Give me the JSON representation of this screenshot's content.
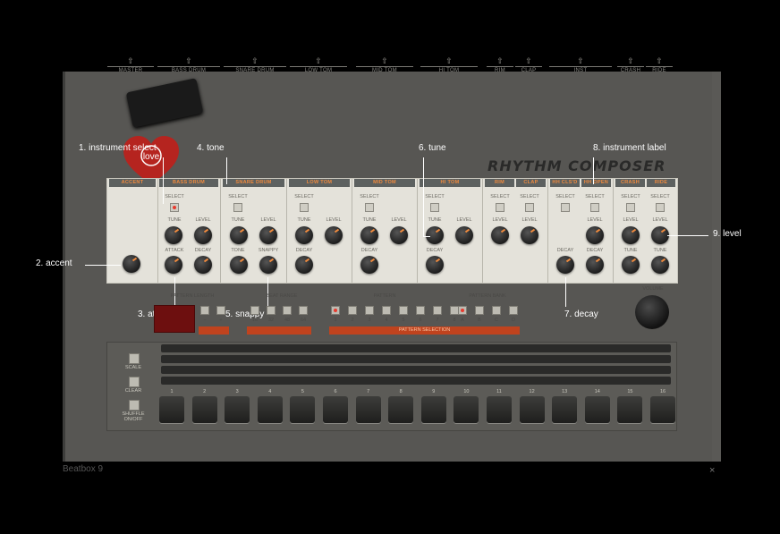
{
  "window": {
    "title": "Beatbox 9",
    "close_glyph": "×"
  },
  "brand": {
    "logo": "RHYTHM COMPOSER",
    "heart_text": "love"
  },
  "outputs": [
    "MASTER",
    "BASS DRUM",
    "SNARE DRUM",
    "LOW TOM",
    "MID TOM",
    "HI TOM",
    "RIM",
    "CLAP",
    "INST",
    "CRASH",
    "RIDE"
  ],
  "panel": {
    "accent": "ACCENT",
    "columns": [
      {
        "name": "BASS DRUM",
        "rows": [
          "SELECT",
          "TUNE",
          "LEVEL",
          "ATTACK",
          "DECAY"
        ]
      },
      {
        "name": "SNARE DRUM",
        "rows": [
          "SELECT",
          "TUNE",
          "LEVEL",
          "TONE",
          "SNAPPY"
        ]
      },
      {
        "name": "LOW TOM",
        "rows": [
          "SELECT",
          "TUNE",
          "LEVEL",
          "DECAY"
        ]
      },
      {
        "name": "MID TOM",
        "rows": [
          "SELECT",
          "TUNE",
          "LEVEL",
          "DECAY"
        ]
      },
      {
        "name": "HI TOM",
        "rows": [
          "SELECT",
          "TUNE",
          "LEVEL",
          "DECAY"
        ]
      },
      {
        "name": "RIM",
        "rows": [
          "SELECT",
          "LEVEL"
        ]
      },
      {
        "name": "CLAP",
        "rows": [
          "SELECT",
          "LEVEL"
        ]
      },
      {
        "name": "HH CLS'D",
        "rows": [
          "SELECT",
          "DECAY"
        ]
      },
      {
        "name": "HH OPEN",
        "rows": [
          "SELECT",
          "LEVEL",
          "DECAY"
        ]
      },
      {
        "name": "CRASH",
        "rows": [
          "SELECT",
          "LEVEL",
          "TUNE"
        ]
      },
      {
        "name": "RIDE",
        "rows": [
          "SELECT",
          "LEVEL",
          "TUNE"
        ]
      }
    ]
  },
  "annotations": {
    "a1": "1. instrument select",
    "a2": "2. accent",
    "a3": "3. attack",
    "a4": "4. tone",
    "a5": "5. snappy",
    "a6": "6. tune",
    "a7": "7. decay",
    "a8": "8. instrument label",
    "a9": "9. level"
  },
  "middle": {
    "pattern_length": "PATTERN LENGTH",
    "pl_minus": "−",
    "pl_plus": "+",
    "beat_range": "BEAT RANGE",
    "beat_values": [
      "16",
      "32",
      "48",
      "64"
    ],
    "pattern": "PATTERN",
    "pattern_nums": [
      "1",
      "2",
      "3",
      "4",
      "5",
      "6",
      "7",
      "8"
    ],
    "pattern_bank": "PATTERN BANK",
    "bank_letters": [
      "A",
      "B",
      "C",
      "D"
    ],
    "pattern_selection": "PATTERN SELECTION",
    "volume": "VOLUME"
  },
  "sequencer": {
    "side": [
      "SCALE",
      "CLEAR",
      "SHUFFLE ON/OFF"
    ],
    "steps": [
      "1",
      "2",
      "3",
      "4",
      "5",
      "6",
      "7",
      "8",
      "9",
      "10",
      "11",
      "12",
      "13",
      "14",
      "15",
      "16"
    ]
  }
}
